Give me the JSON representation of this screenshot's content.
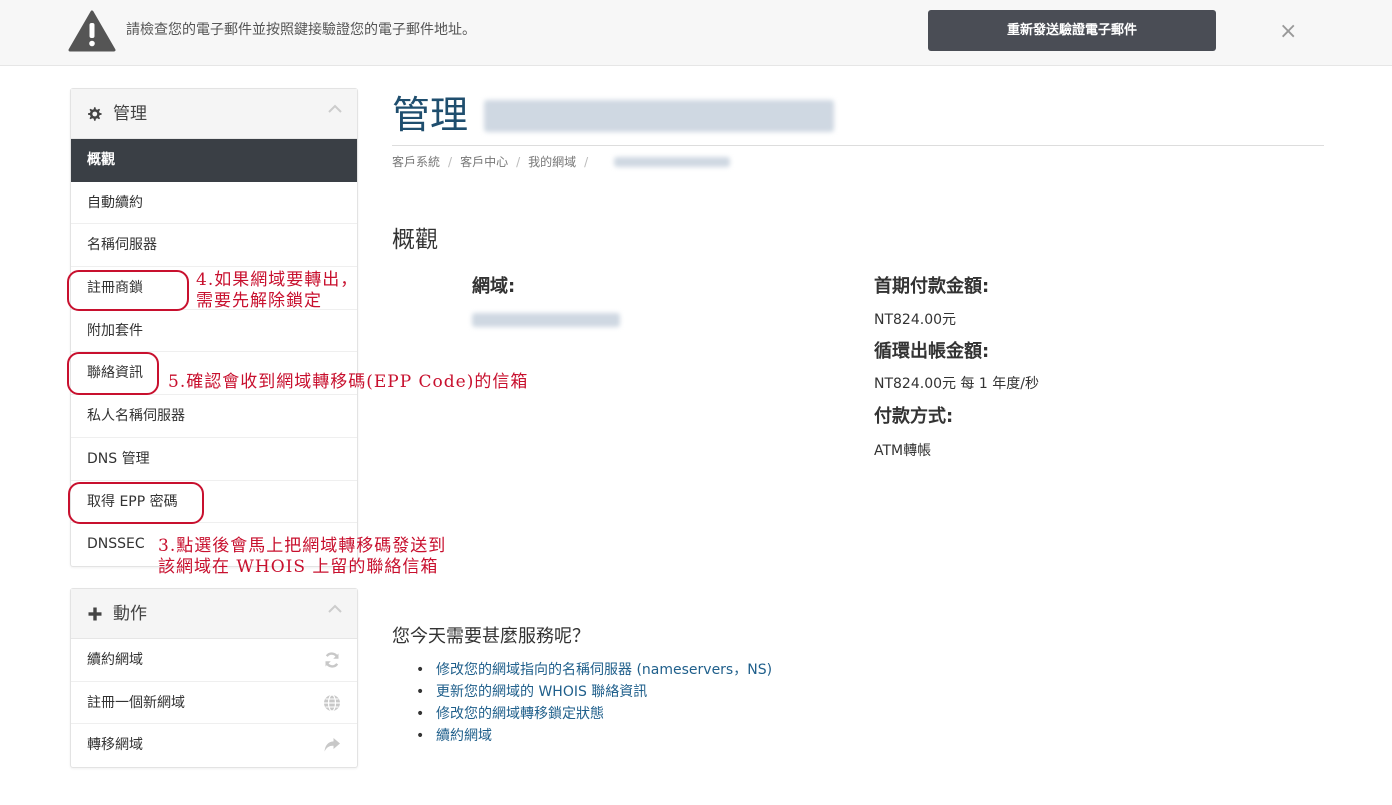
{
  "alert": {
    "message": "請檢查您的電子郵件並按照鍵接驗證您的電子郵件地址。",
    "resend_label": "重新發送驗證電子郵件",
    "close_glyph": "×"
  },
  "sidebar": {
    "manage_title": "管理",
    "items": [
      {
        "label": "概觀",
        "active": true
      },
      {
        "label": "自動續約"
      },
      {
        "label": "名稱伺服器"
      },
      {
        "label": "註冊商鎖"
      },
      {
        "label": "附加套件"
      },
      {
        "label": "聯絡資訊"
      },
      {
        "label": "私人名稱伺服器"
      },
      {
        "label": "DNS 管理"
      },
      {
        "label": "取得 EPP 密碼"
      },
      {
        "label": "DNSSEC"
      }
    ],
    "actions_title": "動作",
    "actions": [
      {
        "label": "續約網域",
        "icon": "refresh-icon"
      },
      {
        "label": "註冊一個新網域",
        "icon": "globe-icon"
      },
      {
        "label": "轉移網域",
        "icon": "share-arrow-icon"
      }
    ]
  },
  "annotations": {
    "note_4": "4.如果網域要轉出，\n需要先解除鎖定",
    "note_5": "5.確認會收到網域轉移碼(EPP Code)的信箱",
    "note_3": "3.點選後會馬上把網域轉移碼發送到\n該網域在 WHOIS 上留的聯絡信箱"
  },
  "main": {
    "title": "管理",
    "breadcrumb": [
      "客戶系統",
      "客戶中心",
      "我的網域"
    ],
    "section_title": "概觀",
    "domain_label": "網域:",
    "first_payment_label": "首期付款金額:",
    "first_payment_value": "NT824.00元",
    "recurring_label": "循環出帳金額:",
    "recurring_value": "NT824.00元 每 1 年度/秒",
    "payment_method_label": "付款方式:",
    "payment_method_value": "ATM轉帳",
    "help_title": "您今天需要甚麼服務呢？",
    "help_links": [
      "修改您的網域指向的名稱伺服器 (nameservers，NS)",
      "更新您的網域的 WHOIS 聯絡資訊",
      "修改您的網域轉移鎖定狀態",
      "續約網域"
    ]
  },
  "colors": {
    "accent_dark": "#3a3f45",
    "title_blue": "#1f4e6e",
    "link_blue": "#1f5f8b",
    "annotation_red": "#c8102e"
  }
}
